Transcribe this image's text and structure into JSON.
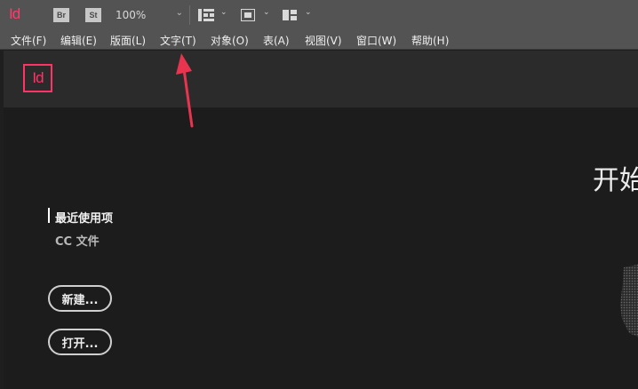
{
  "app": {
    "logo_text": "Id",
    "bridge_label": "Br",
    "stock_label": "St",
    "zoom_value": "100%"
  },
  "menu": [
    {
      "label": "文件(F)"
    },
    {
      "label": "编辑(E)"
    },
    {
      "label": "版面(L)"
    },
    {
      "label": "文字(T)"
    },
    {
      "label": "对象(O)"
    },
    {
      "label": "表(A)"
    },
    {
      "label": "视图(V)"
    },
    {
      "label": "窗口(W)"
    },
    {
      "label": "帮助(H)"
    }
  ],
  "start": {
    "logo_text": "Id",
    "title": "开始",
    "nav": {
      "recent": "最近使用项",
      "cc_files": "CC 文件"
    },
    "buttons": {
      "new": "新建...",
      "open": "打开..."
    }
  },
  "colors": {
    "brand": "#ff3366",
    "toolbar_bg": "#535353",
    "workspace_bg": "#1c1c1c",
    "header_bg": "#2b2b2b",
    "annotation": "#e8344e"
  },
  "icons": {
    "zoom_dropdown": "chevron-down-icon",
    "view_options": "grid-view-icon",
    "screen_mode": "screen-mode-icon",
    "arrange_documents": "arrange-documents-icon"
  }
}
